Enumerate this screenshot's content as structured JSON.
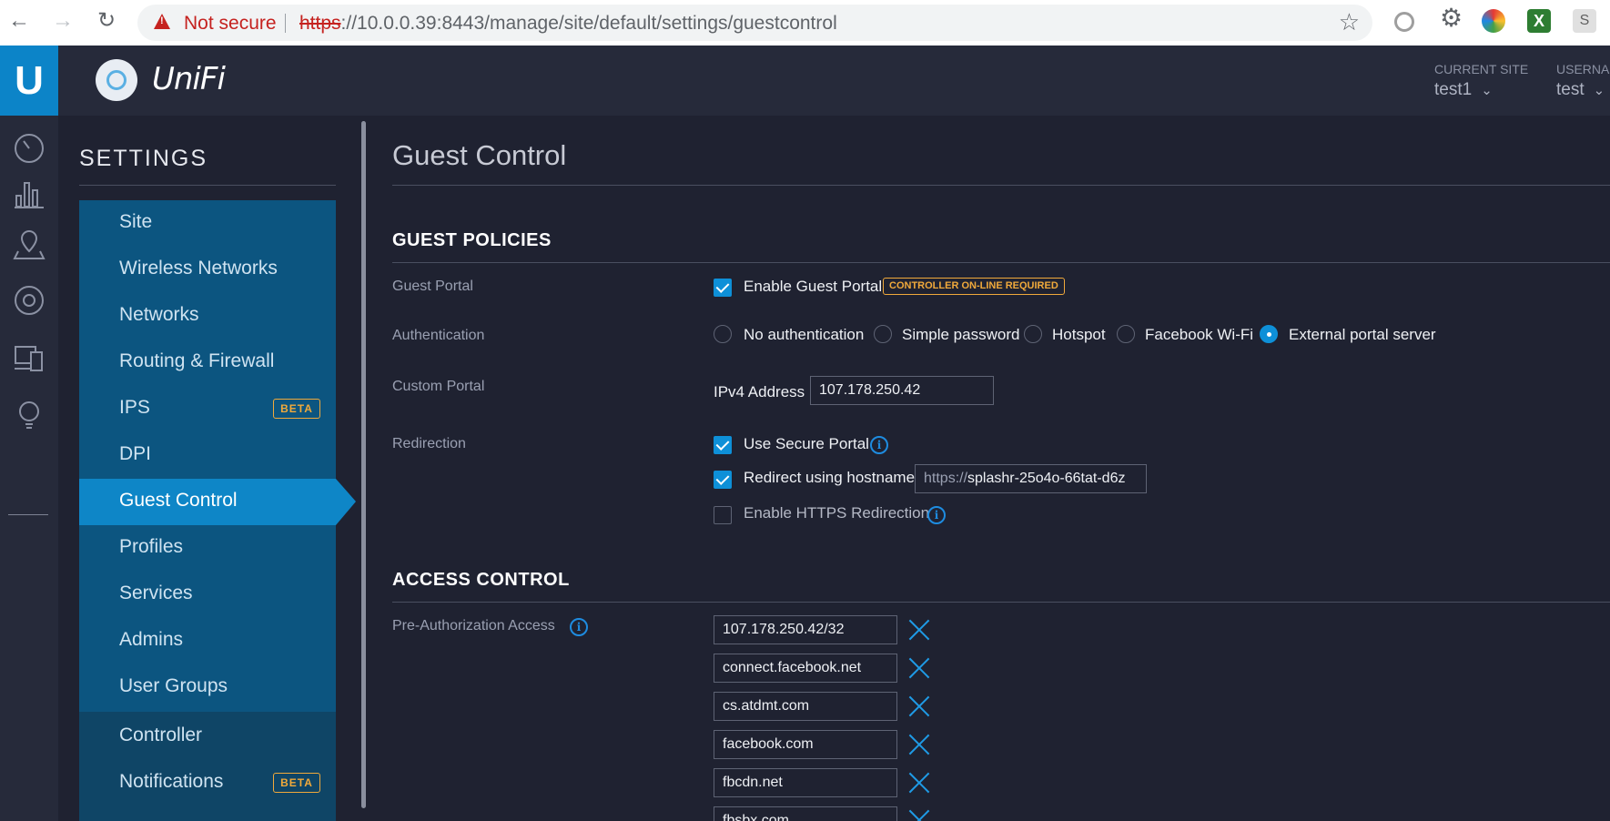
{
  "browser": {
    "warning_text": "Not secure",
    "url_proto": "https",
    "url_rest": "://10.0.0.39:8443/manage/site/default/settings/guestcontrol",
    "url_host": "10.0.0.39",
    "ext_s_label": "S"
  },
  "header": {
    "brand": "UniFi",
    "current_site_label": "CURRENT SITE",
    "current_site_value": "test1",
    "username_label": "USERNAME",
    "username_value": "test"
  },
  "settings": {
    "title": "SETTINGS",
    "items": [
      {
        "label": "Site"
      },
      {
        "label": "Wireless Networks"
      },
      {
        "label": "Networks"
      },
      {
        "label": "Routing & Firewall"
      },
      {
        "label": "IPS",
        "badge": "BETA"
      },
      {
        "label": "DPI"
      },
      {
        "label": "Guest Control"
      },
      {
        "label": "Profiles"
      },
      {
        "label": "Services"
      },
      {
        "label": "Admins"
      },
      {
        "label": "User Groups"
      },
      {
        "label": "Controller"
      },
      {
        "label": "Notifications",
        "badge": "BETA"
      }
    ],
    "active_item": "Guest Control"
  },
  "page": {
    "title": "Guest Control",
    "guest_policies": {
      "heading": "GUEST POLICIES",
      "guest_portal_label": "Guest Portal",
      "enable_guest_portal": "Enable Guest Portal",
      "controller_badge": "CONTROLLER ON-LINE REQUIRED",
      "authentication_label": "Authentication",
      "auth_options": [
        "No authentication",
        "Simple password",
        "Hotspot",
        "Facebook Wi-Fi",
        "External portal server"
      ],
      "auth_selected": "External portal server",
      "custom_portal_label": "Custom Portal",
      "ipv4_label": "IPv4 Address",
      "ipv4_value": "107.178.250.42",
      "redirection_label": "Redirection",
      "use_secure_portal": "Use Secure Portal",
      "redirect_hostname": "Redirect using hostname",
      "hostname_prefix": "https://",
      "hostname_value": "splashr-25o4o-66tat-d6z",
      "enable_https_redirection": "Enable HTTPS Redirection"
    },
    "access_control": {
      "heading": "ACCESS CONTROL",
      "pre_auth_label": "Pre-Authorization Access",
      "pre_auth_entries": [
        "107.178.250.42/32",
        "connect.facebook.net",
        "cs.atdmt.com",
        "facebook.com",
        "fbcdn.net",
        "fbsbx.com"
      ]
    }
  },
  "colors": {
    "accent": "#0e90d8",
    "warning": "#f0a93b",
    "menu_bg": "#0c5580",
    "active_bg": "#0e86c7"
  }
}
